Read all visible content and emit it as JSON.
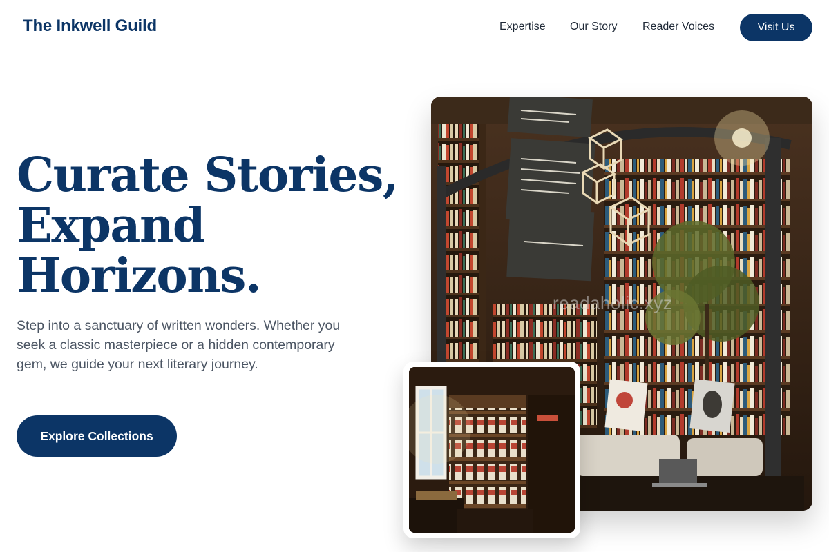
{
  "header": {
    "brand": "The Inkwell Guild",
    "nav": [
      "Expertise",
      "Our Story",
      "Reader Voices"
    ],
    "cta_label": "Visit Us"
  },
  "hero": {
    "headline_lines": [
      "Curate Stories,",
      "Expand",
      "Horizons."
    ],
    "lede": "Step into a sanctuary of written wonders. Whether you seek a classic masterpiece or a hidden contemporary gem, we guide your next literary journey.",
    "cta_label": "Explore Collections"
  },
  "images": {
    "main_watermark": "readaholic.xyz",
    "main_sign_top": "+1 - Strana beletristika / Language learning - Strip / Comics - Café",
    "main_sign_mid": "0 - Beletristika - Knjige na engleskom jeziku / English - Suveniri, pokloni / Souvenirs, gifts - Dečji deo / Kids",
    "main_sign_low": "-1 - Stručna literatura / Academic titles"
  },
  "colors": {
    "brand": "#0c3566",
    "body_text": "#4b5563",
    "nav_text": "#1f2937"
  }
}
